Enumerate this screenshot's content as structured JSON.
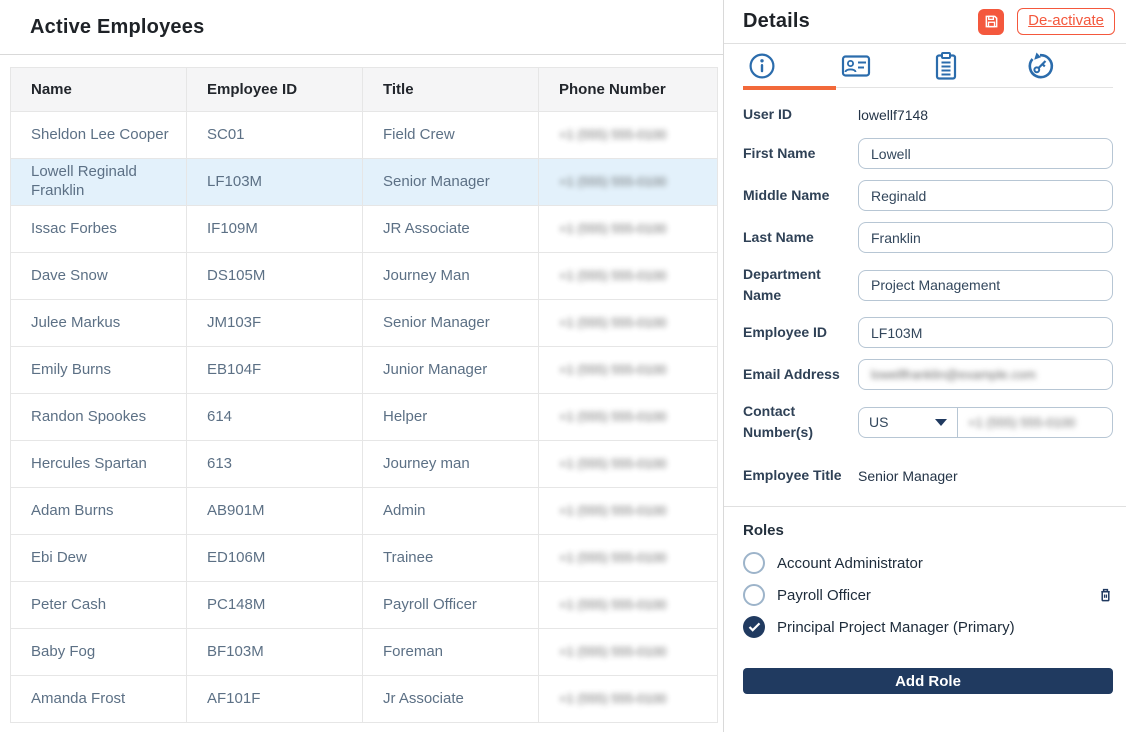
{
  "colors": {
    "accent_orange": "#f4583d",
    "tab_active_underline": "#f2693a",
    "navy": "#203a60",
    "tab_icon_blue": "#2b6cac",
    "selected_row_bg": "#e3f1fb"
  },
  "left": {
    "title": "Active Employees",
    "table": {
      "headers": [
        "Name",
        "Employee ID",
        "Title",
        "Phone Number"
      ],
      "selected_index": 1,
      "phone_redacted": true,
      "phone_redacted_text": "+1 (555) 555-0100",
      "rows": [
        {
          "name": "Sheldon Lee Cooper",
          "employee_id": "SC01",
          "title": "Field Crew"
        },
        {
          "name": "Lowell Reginald Franklin",
          "employee_id": "LF103M",
          "title": "Senior Manager"
        },
        {
          "name": "Issac Forbes",
          "employee_id": "IF109M",
          "title": "JR Associate"
        },
        {
          "name": "Dave Snow",
          "employee_id": "DS105M",
          "title": "Journey Man"
        },
        {
          "name": "Julee Markus",
          "employee_id": "JM103F",
          "title": "Senior Manager"
        },
        {
          "name": "Emily Burns",
          "employee_id": "EB104F",
          "title": "Junior Manager"
        },
        {
          "name": "Randon Spookes",
          "employee_id": "614",
          "title": "Helper"
        },
        {
          "name": "Hercules Spartan",
          "employee_id": "613",
          "title": "Journey man"
        },
        {
          "name": "Adam Burns",
          "employee_id": "AB901M",
          "title": "Admin"
        },
        {
          "name": "Ebi Dew",
          "employee_id": "ED106M",
          "title": "Trainee"
        },
        {
          "name": "Peter Cash",
          "employee_id": "PC148M",
          "title": "Payroll Officer"
        },
        {
          "name": "Baby Fog",
          "employee_id": "BF103M",
          "title": "Foreman"
        },
        {
          "name": "Amanda Frost",
          "employee_id": "AF101F",
          "title": "Jr Associate"
        }
      ]
    }
  },
  "details": {
    "title": "Details",
    "save_icon": "floppy-disk",
    "deactivate_label": "De-activate",
    "tabs": [
      {
        "icon": "info",
        "active": true
      },
      {
        "icon": "id-card",
        "active": false
      },
      {
        "icon": "clipboard",
        "active": false
      },
      {
        "icon": "reset-key",
        "active": false
      }
    ],
    "fields": {
      "user_id": {
        "label": "User ID",
        "value": "lowellf7148"
      },
      "first_name": {
        "label": "First Name",
        "value": "Lowell"
      },
      "middle_name": {
        "label": "Middle Name",
        "value": "Reginald"
      },
      "last_name": {
        "label": "Last Name",
        "value": "Franklin"
      },
      "department": {
        "label": "Department Name",
        "value": "Project Management"
      },
      "employee_id": {
        "label": "Employee ID",
        "value": "LF103M"
      },
      "email": {
        "label": "Email Address",
        "redacted": true,
        "redacted_text": "lowellfranklin@example.com"
      },
      "contact": {
        "label": "Contact Number(s)",
        "country": "US",
        "redacted": true,
        "redacted_text": "+1 (555) 555-0100"
      },
      "employee_title": {
        "label": "Employee Title",
        "value": "Senior Manager"
      }
    },
    "roles": {
      "heading": "Roles",
      "options": [
        {
          "label": "Account Administrator",
          "checked": false
        },
        {
          "label": "Payroll Officer",
          "checked": false,
          "deletable": true
        },
        {
          "label": "Principal Project Manager (Primary)",
          "checked": true
        }
      ],
      "add_button_label": "Add Role"
    }
  }
}
